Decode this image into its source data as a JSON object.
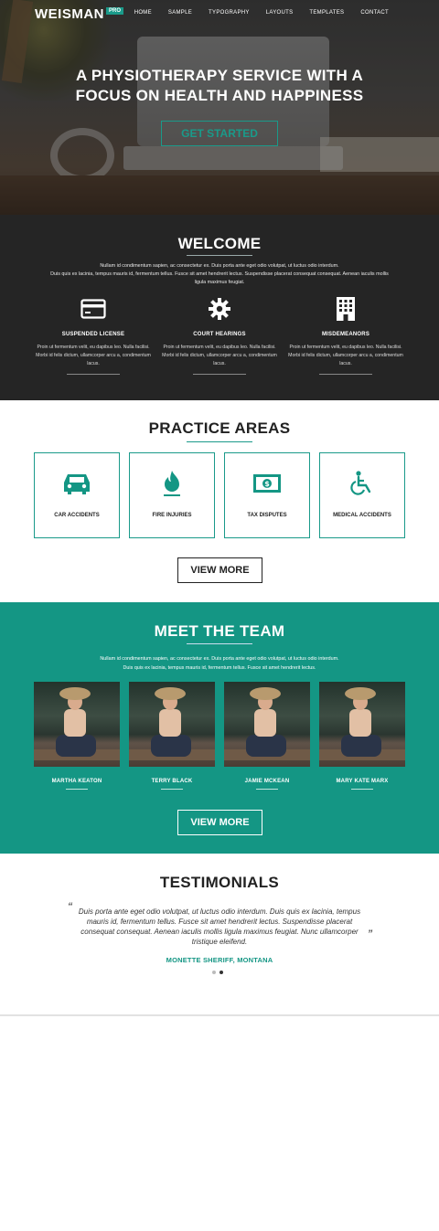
{
  "header": {
    "logo": "WEISMAN",
    "logo_badge": "PRO",
    "nav": [
      "HOME",
      "SAMPLE",
      "TYPOGRAPHY",
      "LAYOUTS",
      "TEMPLATES",
      "CONTACT"
    ]
  },
  "hero": {
    "headline_line1": "A PHYSIOTHERAPY SERVICE WITH A",
    "headline_line2": "FOCUS ON HEALTH AND HAPPINESS",
    "cta": "GET STARTED"
  },
  "welcome": {
    "title": "WELCOME",
    "intro_line1": "Nullam id condimentum sapien, ac consectetur ex. Duis porta ante eget odio volutpat, ut luctus odio interdum.",
    "intro_line2": "Duis quis ex lacinia, tempus mauris id, fermentum tellus. Fusce sit amet hendrerit lectus. Suspendisse placerat consequat consequat. Aenean iaculis mollis",
    "intro_line3": "ligula maximus feugiat.",
    "features": [
      {
        "icon": "credit-card-icon",
        "title": "SUSPENDED LICENSE",
        "desc": "Proin ut fermentum velit, eu dapibus leo. Nulla facilisi. Morbi id felis dictum, ullamcorper arcu a, condimentum lacus."
      },
      {
        "icon": "gear-icon",
        "title": "COURT HEARINGS",
        "desc": "Proin ut fermentum velit, eu dapibus leo. Nulla facilisi. Morbi id felis dictum, ullamcorper arcu a, condimentum lacus."
      },
      {
        "icon": "building-icon",
        "title": "MISDEMEANORS",
        "desc": "Proin ut fermentum velit, eu dapibus leo. Nulla facilisi. Morbi id felis dictum, ullamcorper arcu a, condimentum lacus."
      }
    ]
  },
  "practice": {
    "title": "PRACTICE AREAS",
    "cards": [
      {
        "icon": "car-icon",
        "label": "CAR ACCIDENTS"
      },
      {
        "icon": "fire-icon",
        "label": "FIRE INJURIES"
      },
      {
        "icon": "money-icon",
        "label": "TAX DISPUTES"
      },
      {
        "icon": "wheelchair-icon",
        "label": "MEDICAL ACCIDENTS"
      }
    ],
    "button": "VIEW MORE"
  },
  "team": {
    "title": "MEET THE TEAM",
    "intro_line1": "Nullam id condimentum sapien, ac consectetur ex. Duis porta ante eget odio volutpat, ut luctus odio interdum.",
    "intro_line2": "Duis quis ex lacinia, tempus mauris id, fermentum tellus. Fusce sit amet hendrerit lectus.",
    "members": [
      "MARTHA KEATON",
      "TERRY BLACK",
      "JAMIE MCKEAN",
      "MARY KATE MARX"
    ],
    "button": "VIEW MORE"
  },
  "testimonials": {
    "title": "TESTIMONIALS",
    "quote_open": "“",
    "quote_close": "”",
    "quote": "Duis porta ante eget odio volutpat, ut luctus odio interdum. Duis quis ex lacinia, tempus mauris id, fermentum tellus. Fusce sit amet hendrerit lectus. Suspendisse placerat consequat consequat. Aenean iaculis mollis ligula maximus feugiat. Nunc ullamcorper tristique eleifend.",
    "author": "MONETTE SHERIFF, MONTANA"
  },
  "colors": {
    "accent": "#149684",
    "dark": "#252525"
  }
}
